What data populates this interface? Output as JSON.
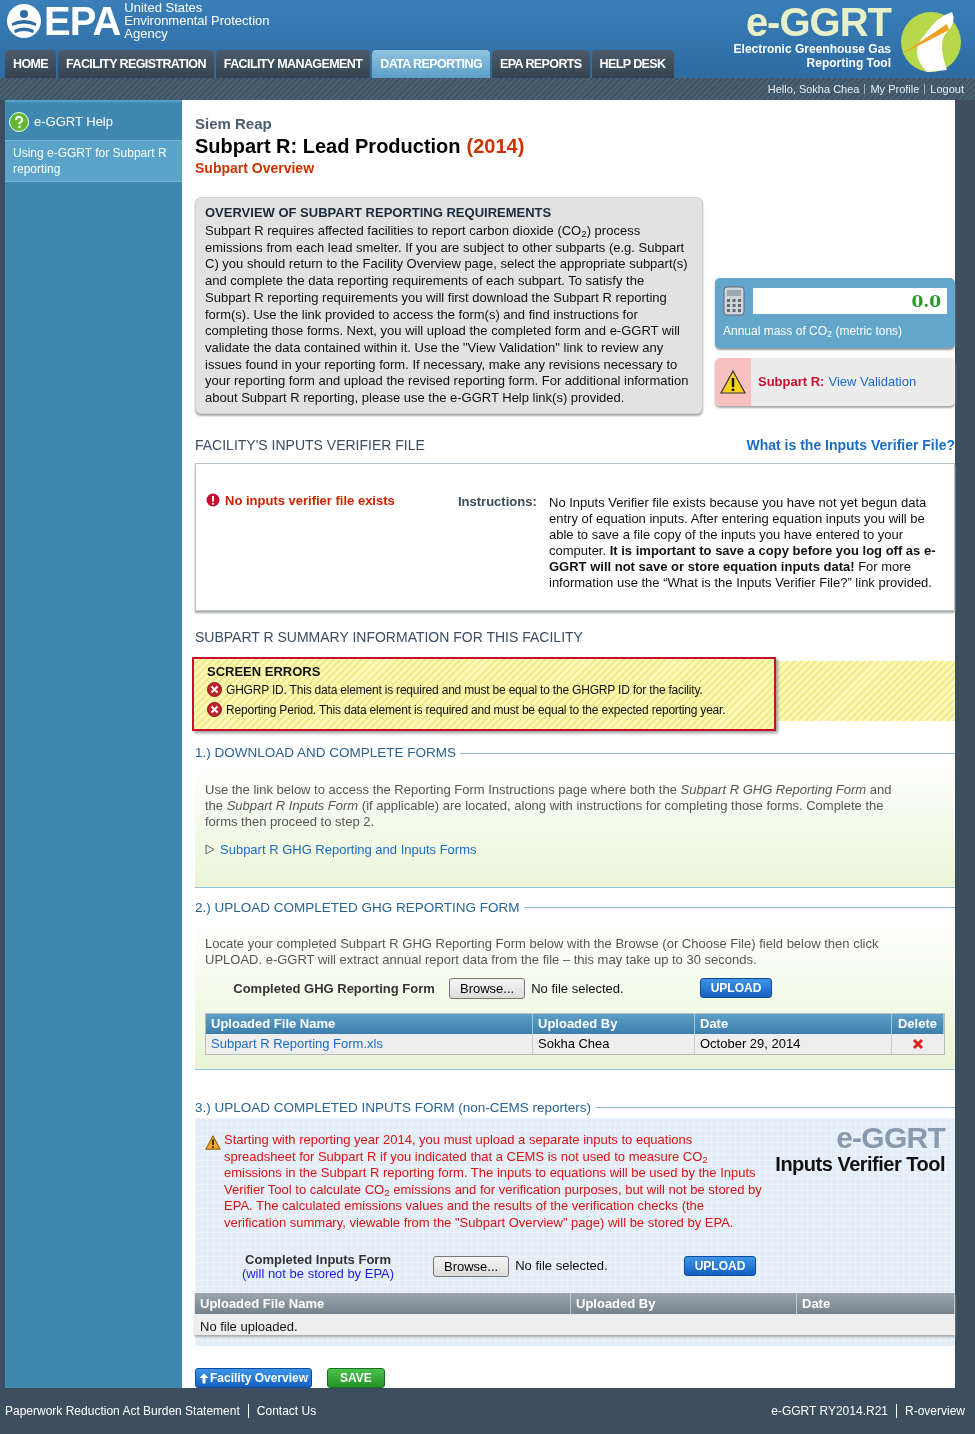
{
  "header": {
    "agency": [
      "United States",
      "Environmental Protection",
      "Agency"
    ],
    "logo_text": "EPA",
    "tool_logo": "e-GGRT",
    "tool_name": [
      "Electronic Greenhouse Gas",
      "Reporting Tool"
    ]
  },
  "nav_tabs": [
    {
      "label": "HOME",
      "selected": false
    },
    {
      "label": "FACILITY REGISTRATION",
      "selected": false
    },
    {
      "label": "FACILITY MANAGEMENT",
      "selected": false
    },
    {
      "label": "DATA REPORTING",
      "selected": true
    },
    {
      "label": "EPA REPORTS",
      "selected": false
    },
    {
      "label": "HELP DESK",
      "selected": false
    }
  ],
  "user_bar": {
    "greeting": "Hello, Sokha Chea",
    "links": [
      "My Profile",
      "Logout"
    ]
  },
  "sidebar": {
    "items": [
      {
        "kind": "help",
        "label": "e-GGRT Help"
      },
      {
        "kind": "link",
        "label": "Using e-GGRT for Subpart R reporting"
      }
    ]
  },
  "page": {
    "facility": "Siem Reap",
    "title": "Subpart R: Lead Production",
    "year": "(2014)",
    "subtitle": "Subpart Overview"
  },
  "overview": {
    "heading": "OVERVIEW OF SUBPART REPORTING REQUIREMENTS",
    "text": "Subpart R requires affected facilities to report carbon dioxide (CO$_{2}$) process emissions from each lead smelter. If you are subject to other subparts (e.g. Subpart C) you should return to the Facility Overview page, select the appropriate subpart(s) and complete the data reporting requirements of each subpart. To satisfy the Subpart R reporting requirements you will first download the Subpart R reporting form(s). Use the link provided to access the form(s) and find instructions for completing those forms. Next, you will upload the completed form and e-GGRT will validate the data contained within it. Use the \"View Validation\" link to review any issues found in your reporting form. If necessary, make any revisions necessary to your reporting form and upload the revised reporting form. For additional information about Subpart R reporting, please use the e-GGRT Help link(s) provided."
  },
  "co2_meter": {
    "value": "0.0",
    "label": "Annual mass of CO$_{2}$ (metric tons)"
  },
  "validation": {
    "label": "Subpart R:",
    "link": "View Validation"
  },
  "verifier": {
    "heading": "FACILITY'S INPUTS VERIFIER FILE",
    "help_link": "What is the Inputs Verifier File?",
    "status": "No inputs verifier file exists",
    "instructions_label": "Instructions:",
    "instructions": "No Inputs Verifier file exists because you have not yet begun data entry of equation inputs.  After entering equation inputs you will be able to save a file copy of the inputs you have entered to your computer.  **It is important to save a copy before you log off as e-GGRT will not save or store equation inputs data!** For more information use the “What is the Inputs Verifier File?” link provided."
  },
  "summary": {
    "heading": "SUBPART R SUMMARY INFORMATION FOR THIS FACILITY",
    "errors_title": "SCREEN ERRORS",
    "errors": [
      "GHGRP ID. This data element is required and must be equal to the GHGRP ID for the facility.",
      "Reporting Period. This data element is required and must be equal to the expected reporting year."
    ]
  },
  "step1": {
    "heading": "1.) DOWNLOAD AND COMPLETE FORMS",
    "text": "Use the link below to access the Reporting Form Instructions page where both the *Subpart R GHG Reporting Form* and the *Subpart R Inputs Form* (if applicable) are located, along with instructions for completing those forms. Complete the forms then proceed to step 2.",
    "link": "Subpart R GHG Reporting and Inputs Forms"
  },
  "step2": {
    "heading": "2.) UPLOAD COMPLETED GHG REPORTING FORM",
    "text": "Locate your completed Subpart R GHG Reporting Form below with the Browse (or Choose File) field below then click UPLOAD. e-GGRT will extract annual report data from the file – this may take up to 30 seconds.",
    "field_label": "Completed GHG Reporting Form",
    "browse": "Browse...",
    "file_status": "No file selected.",
    "upload": "UPLOAD",
    "columns": [
      "Uploaded File Name",
      "Uploaded By",
      "Date",
      "Delete"
    ],
    "rows": [
      {
        "file": "Subpart R Reporting Form.xls",
        "by": "Sokha Chea",
        "date": "October 29, 2014"
      }
    ]
  },
  "step3": {
    "heading": "3.) UPLOAD COMPLETED INPUTS FORM (non-CEMS reporters)",
    "warning": "Starting with reporting year 2014, you must upload a separate inputs to equations spreadsheet for Subpart R if you indicated that a CEMS is not used to measure CO$_{2}$ emissions in the Subpart R reporting form. The inputs to equations will be used by the Inputs Verifier Tool to calculate CO$_{2}$ emissions and for verification purposes, but will not be stored by EPA. The calculated emissions values and the results of the verification checks (the verification summary, viewable from the \"Subpart Overview\" page) will be stored by EPA.",
    "logo_text": "e-GGRT",
    "logo_title": "Inputs Verifier Tool",
    "field_label": "Completed Inputs Form",
    "field_note": "(will not be stored by EPA)",
    "browse": "Browse...",
    "file_status": "No file selected.",
    "upload": "UPLOAD",
    "columns": [
      "Uploaded File Name",
      "Uploaded By",
      "Date"
    ],
    "empty": "No file uploaded."
  },
  "actions": [
    {
      "kind": "back",
      "label": "Facility Overview"
    },
    {
      "kind": "save",
      "label": "SAVE"
    }
  ],
  "footer": {
    "left": [
      "Paperwork Reduction Act Burden Statement",
      "Contact Us"
    ],
    "right": [
      "e-GGRT RY2014.R21",
      "R-overview"
    ]
  }
}
